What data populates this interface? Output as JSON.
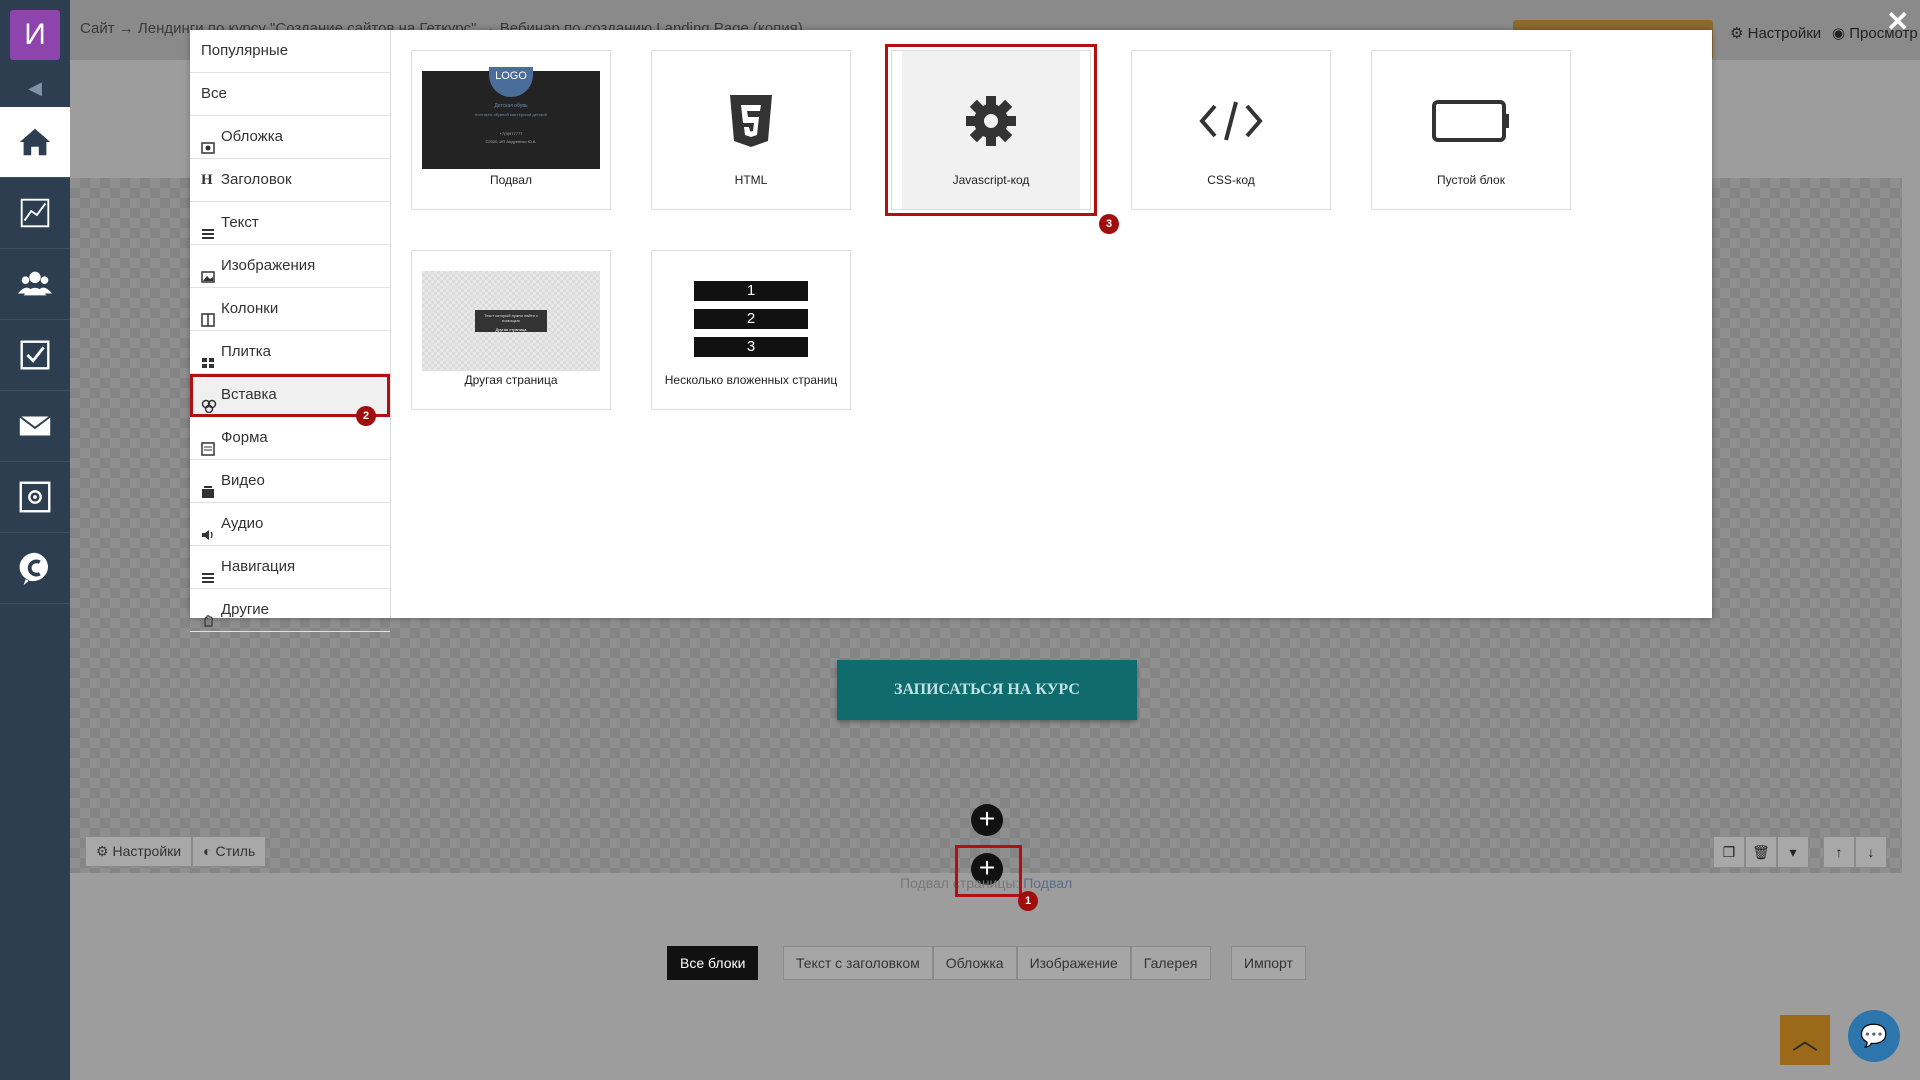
{
  "left_nav": {
    "avatar_letter": "И",
    "items": [
      {
        "icon": "home-icon",
        "active": true
      },
      {
        "icon": "chart-icon",
        "active": false
      },
      {
        "icon": "users-icon",
        "active": false
      },
      {
        "icon": "tasks-icon",
        "active": false
      },
      {
        "icon": "mail-icon",
        "active": false
      },
      {
        "icon": "safe-icon",
        "active": false
      },
      {
        "icon": "chat-c-icon",
        "active": false
      }
    ]
  },
  "topbar": {
    "breadcrumb": "Сайт → Лендинги по курсу \"Создание сайтов на Геткурс\" → Вебинар по созданию Landing Page (копия)",
    "settings_label": "Настройки",
    "preview_label": "Просмотр"
  },
  "canvas": {
    "cta_label": "ЗАПИСАТЬСЯ НА КУРС",
    "block_settings_label": "Настройки",
    "block_style_label": "Стиль",
    "footer_label_prefix": "Подвал страницы:",
    "footer_label_link": "Подвал"
  },
  "bottom_tabs": {
    "all_blocks": "Все блоки",
    "items": [
      "Текст с заголовком",
      "Обложка",
      "Изображение",
      "Галерея"
    ],
    "import": "Импорт"
  },
  "modal": {
    "categories": [
      {
        "label": "Популярные",
        "icon": ""
      },
      {
        "label": "Все",
        "icon": ""
      },
      {
        "label": "Обложка",
        "icon": "cover-icon"
      },
      {
        "label": "Заголовок",
        "icon": "header-icon"
      },
      {
        "label": "Текст",
        "icon": "text-icon"
      },
      {
        "label": "Изображения",
        "icon": "image-icon"
      },
      {
        "label": "Колонки",
        "icon": "columns-icon"
      },
      {
        "label": "Плитка",
        "icon": "tiles-icon"
      },
      {
        "label": "Вставка",
        "icon": "insert-icon",
        "highlighted": true
      },
      {
        "label": "Форма",
        "icon": "form-icon"
      },
      {
        "label": "Видео",
        "icon": "video-icon"
      },
      {
        "label": "Аудио",
        "icon": "audio-icon"
      },
      {
        "label": "Навигация",
        "icon": "nav-icon"
      },
      {
        "label": "Другие",
        "icon": "other-icon"
      }
    ],
    "blocks": [
      {
        "label": "Подвал",
        "icon": "footer-thumb",
        "thumb_text": {
          "logo": "LOGO",
          "line1": "Детская обувь",
          "line2": "Контакты обувной мастерской детской",
          "phone": "+7(9)977777",
          "copy": "©2020, ИП Андреенко Ю.А."
        }
      },
      {
        "label": "HTML",
        "icon": "html5-icon"
      },
      {
        "label": "Javascript-код",
        "icon": "gear-icon",
        "selected": true
      },
      {
        "label": "CSS-код",
        "icon": "code-icon"
      },
      {
        "label": "Пустой блок",
        "icon": "empty-block-icon"
      },
      {
        "label": "Другая страница",
        "icon": "other-page-thumb",
        "thumb_text": {
          "line1": "Текст который нужно найти с помощью",
          "line2": "Другая страница"
        }
      },
      {
        "label": "Несколько вложенных страниц",
        "icon": "nested-pages-thumb",
        "numbers": [
          "1",
          "2",
          "3"
        ]
      }
    ]
  },
  "annotations": [
    "1",
    "2",
    "3"
  ],
  "colors": {
    "highlight": "#b01010",
    "cta": "#0f6b6e",
    "nav": "#2c3e50",
    "avatar": "#8e44ad"
  }
}
